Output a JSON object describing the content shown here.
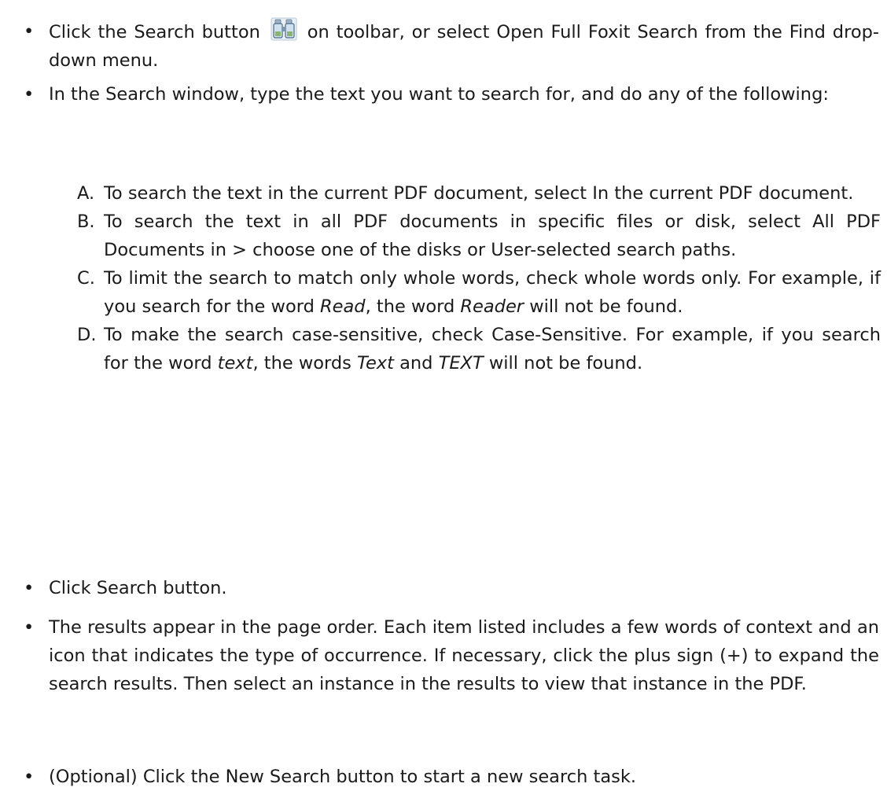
{
  "bullets": [
    {
      "mark": "•",
      "part1": "Click the Search button",
      "icon": "binoculars-search-icon",
      "part2": "on toolbar, or select Open Full Foxit Search from the Find drop-down menu."
    },
    {
      "mark": "•",
      "text": "In the Search window, type the text you want to search for, and do any of the following:"
    },
    {
      "mark": "•",
      "text": "Click Search button."
    },
    {
      "mark": "•",
      "text": "The results appear in the page order. Each item listed includes a few words of context and an icon that indicates the type of occurrence. If necessary, click the plus sign (+) to expand the search results. Then select an instance in the results to view that instance in the PDF."
    },
    {
      "mark": "•",
      "text": "(Optional) Click the New Search button to start a new search task."
    }
  ],
  "options": [
    {
      "letter": "A.",
      "text": "To search the text in the current PDF document, select In the current PDF document."
    },
    {
      "letter": "B.",
      "text": "To search the text in all PDF documents in specific files or disk, select All PDF Documents in > choose one of the disks or User-selected search paths."
    },
    {
      "letter": "C.",
      "pre": "To limit the search to match only whole words, check whole words only. For example, if you search for the word ",
      "em1": "Read",
      "mid": ", the word ",
      "em2": "Reader",
      "post": " will not be found."
    },
    {
      "letter": "D.",
      "pre": "To make the search case-sensitive, check Case-Sensitive. For example, if you search for the word ",
      "em1": "text",
      "mid": ", the words ",
      "em2": "Text",
      "mid2": " and ",
      "em3": "TEXT",
      "post": " will not be found."
    }
  ]
}
